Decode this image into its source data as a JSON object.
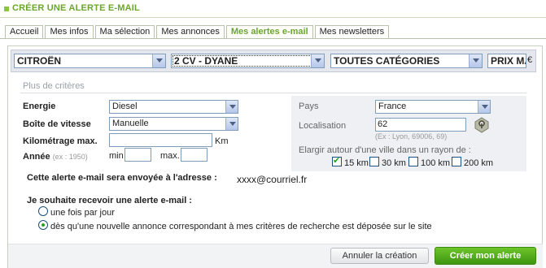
{
  "header": {
    "title": "CRÉER UNE ALERTE E-MAIL"
  },
  "tabs": [
    {
      "label": "Accueil"
    },
    {
      "label": "Mes infos"
    },
    {
      "label": "Ma sélection"
    },
    {
      "label": "Mes annonces"
    },
    {
      "label": "Mes alertes e-mail",
      "active": true
    },
    {
      "label": "Mes newsletters"
    }
  ],
  "search": {
    "brand": "CITROËN",
    "model": "2 CV - DYANE",
    "category": "TOUTES CATÉGORIES",
    "price": "PRIX MA",
    "currency": "€"
  },
  "criteria": {
    "title": "Plus de critères",
    "energy_label": "Energie",
    "energy_value": "Diesel",
    "gearbox_label": "Boîte de vitesse",
    "gearbox_value": "Manuelle",
    "mileage_label": "Kilométrage max.",
    "mileage_value": "",
    "mileage_unit": "Km",
    "year_label": "Année",
    "year_example": "(ex : 1950)",
    "year_min_label": "min",
    "year_max_label": "max."
  },
  "location": {
    "country_label": "Pays",
    "country_value": "France",
    "locality_label": "Localisation",
    "locality_value": "62",
    "locality_hint": "(Ex : Lyon, 69006, 69)",
    "radius_label": "Elargir autour d'une ville dans un rayon de :",
    "radius_options": [
      {
        "label": "15 km",
        "checked": true
      },
      {
        "label": "30 km",
        "checked": false
      },
      {
        "label": "100 km",
        "checked": false
      },
      {
        "label": "200 km",
        "checked": false
      }
    ]
  },
  "email": {
    "sent_to_label": "Cette alerte e-mail sera envoyée à l'adresse :",
    "address": "xxxx@courriel.fr"
  },
  "frequency": {
    "label": "Je souhaite recevoir une alerte e-mail :",
    "options": [
      {
        "label": "une fois par jour",
        "selected": false
      },
      {
        "label": "dès qu'une nouvelle annonce correspondant à mes critères de recherche est déposée sur le site",
        "selected": true
      }
    ]
  },
  "buttons": {
    "cancel": "Annuler la création",
    "create": "Créer mon alerte"
  },
  "colors": {
    "accent": "#6aa62a",
    "button_green": "#4fa81b"
  }
}
